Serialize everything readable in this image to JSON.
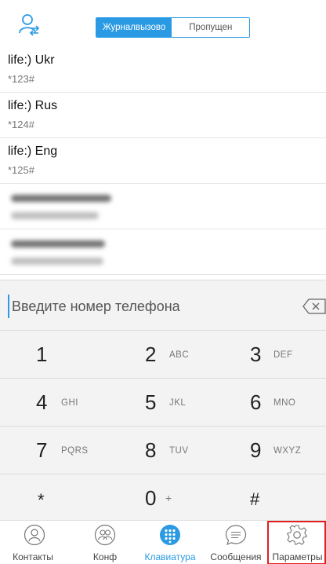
{
  "header": {
    "tabs": [
      {
        "label": "Журналвызово",
        "active": true
      },
      {
        "label": "Пропущен",
        "active": false
      }
    ]
  },
  "call_log": [
    {
      "name": "life:) Ukr",
      "number": "*123#"
    },
    {
      "name": "life:) Rus",
      "number": "*124#"
    },
    {
      "name": "life:) Eng",
      "number": "*125#"
    }
  ],
  "dialer": {
    "placeholder": "Введите номер телефона",
    "keys": [
      {
        "digit": "1",
        "letters": ""
      },
      {
        "digit": "2",
        "letters": "ABC"
      },
      {
        "digit": "3",
        "letters": "DEF"
      },
      {
        "digit": "4",
        "letters": "GHI"
      },
      {
        "digit": "5",
        "letters": "JKL"
      },
      {
        "digit": "6",
        "letters": "MNO"
      },
      {
        "digit": "7",
        "letters": "PQRS"
      },
      {
        "digit": "8",
        "letters": "TUV"
      },
      {
        "digit": "9",
        "letters": "WXYZ"
      },
      {
        "digit": "*",
        "letters": ""
      },
      {
        "digit": "0",
        "letters": "+"
      },
      {
        "digit": "#",
        "letters": ""
      }
    ]
  },
  "bottom_nav": [
    {
      "label": "Контакты",
      "icon": "contacts-icon"
    },
    {
      "label": "Конф",
      "icon": "conference-icon"
    },
    {
      "label": "Клавиатура",
      "icon": "keypad-icon",
      "active": true
    },
    {
      "label": "Сообщения",
      "icon": "messages-icon"
    },
    {
      "label": "Параметры",
      "icon": "settings-icon",
      "highlighted": true
    }
  ],
  "colors": {
    "accent": "#2a9ae4",
    "highlight": "#e02020",
    "dialpad_bg": "#f3f3f3"
  }
}
